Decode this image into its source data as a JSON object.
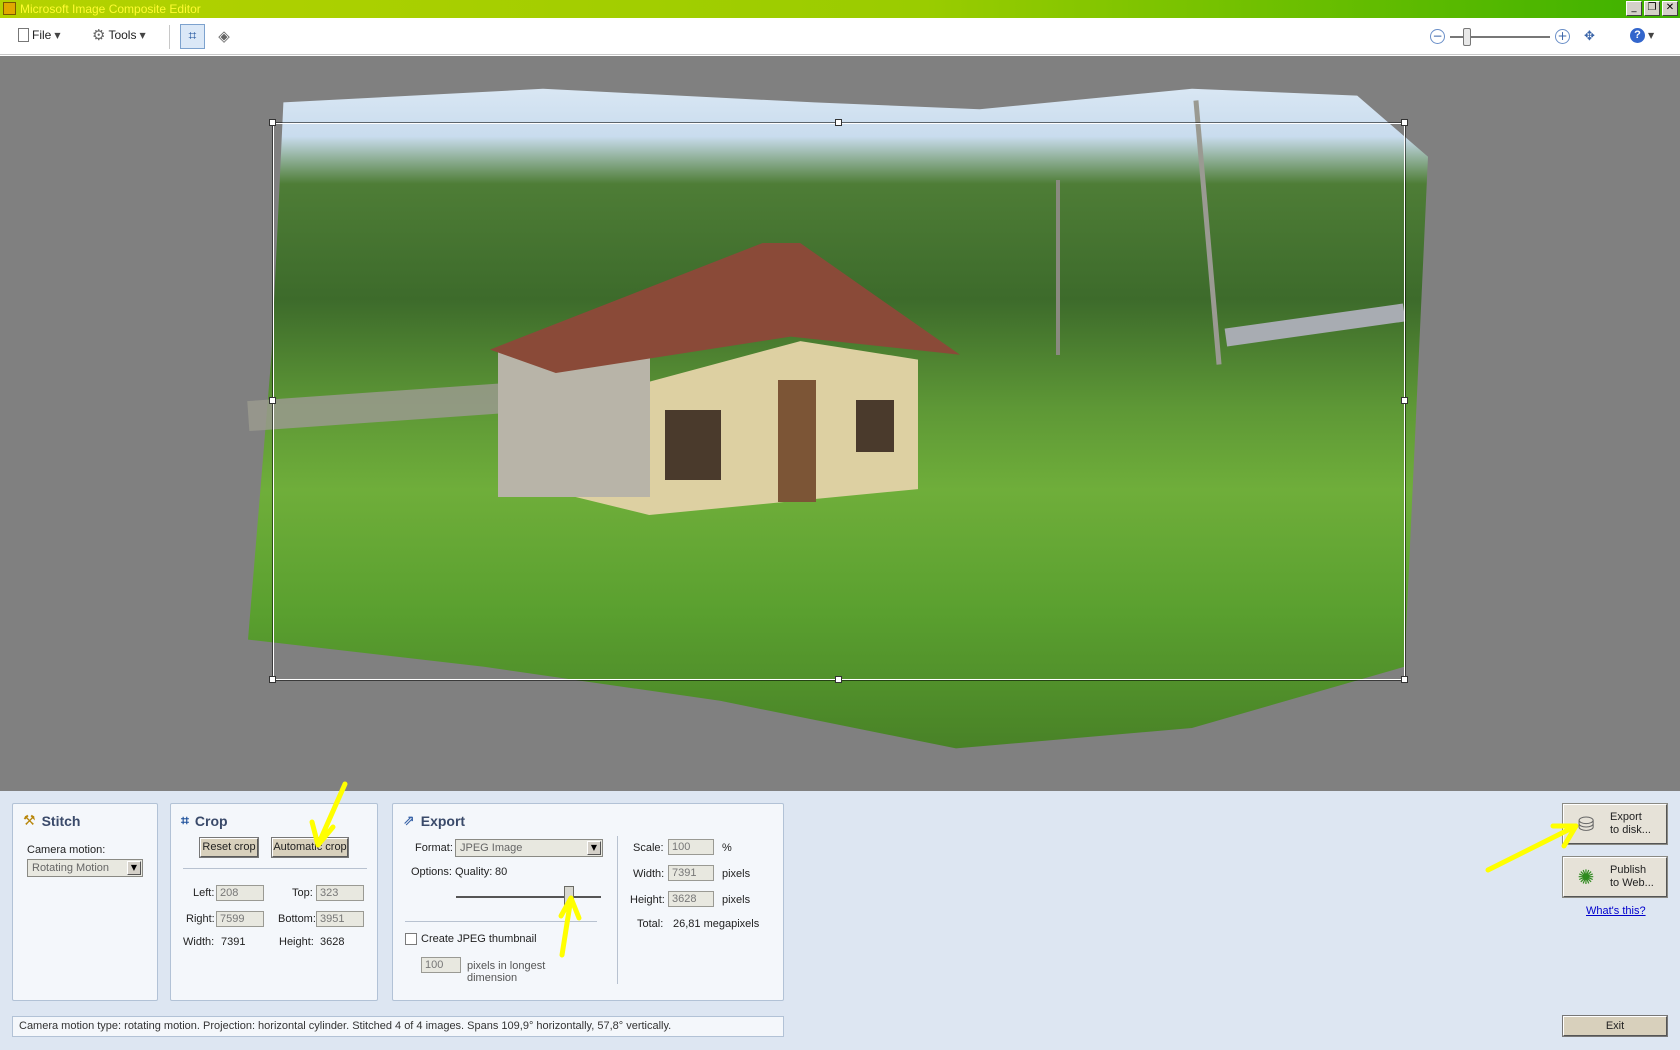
{
  "window": {
    "title": "Microsoft Image Composite Editor",
    "buttons": [
      "_",
      "❐",
      "✕"
    ]
  },
  "toolbar": {
    "file_label": "File",
    "tools_label": "Tools",
    "crop_tool": "crop-icon",
    "projection_tool": "projection-icon",
    "zoom_level_fraction": 0.15,
    "help_label": "?"
  },
  "stitch": {
    "title": "Stitch",
    "camera_motion_label": "Camera motion:",
    "camera_motion_value": "Rotating Motion"
  },
  "crop": {
    "title": "Crop",
    "reset_label": "Reset crop",
    "auto_label": "Automatic crop",
    "left_label": "Left:",
    "left_value": "208",
    "top_label": "Top:",
    "top_value": "323",
    "right_label": "Right:",
    "right_value": "7599",
    "bottom_label": "Bottom:",
    "bottom_value": "3951",
    "width_label": "Width:",
    "width_value": "7391",
    "height_label": "Height:",
    "height_value": "3628"
  },
  "export": {
    "title": "Export",
    "format_label": "Format:",
    "format_value": "JPEG Image",
    "options_label": "Options:",
    "quality_label": "Quality:",
    "quality_value": "80",
    "thumbnail_label": "Create JPEG thumbnail",
    "thumbnail_checked": false,
    "thumb_size_value": "100",
    "thumb_size_label": "pixels in longest\ndimension",
    "scale_label": "Scale:",
    "scale_value": "100",
    "scale_unit": "%",
    "width_label": "Width:",
    "width_value": "7391",
    "width_unit": "pixels",
    "height_label": "Height:",
    "height_value": "3628",
    "height_unit": "pixels",
    "total_label": "Total:",
    "total_value": "26,81 megapixels"
  },
  "actions": {
    "export_disk_label": "Export\nto disk...",
    "publish_web_label": "Publish\nto Web...",
    "whats_this_label": "What's this?",
    "exit_label": "Exit"
  },
  "status_text": "Camera motion type: rotating motion. Projection: horizontal cylinder. Stitched 4 of 4 images. Spans 109,9° horizontally, 57,8° vertically.",
  "colors": {
    "titlebar_start": "#b4d200",
    "titlebar_end": "#3cb100",
    "annotation_arrow": "#ffff00",
    "canvas_bg": "#808080",
    "panel_bg": "#dde6f2"
  }
}
